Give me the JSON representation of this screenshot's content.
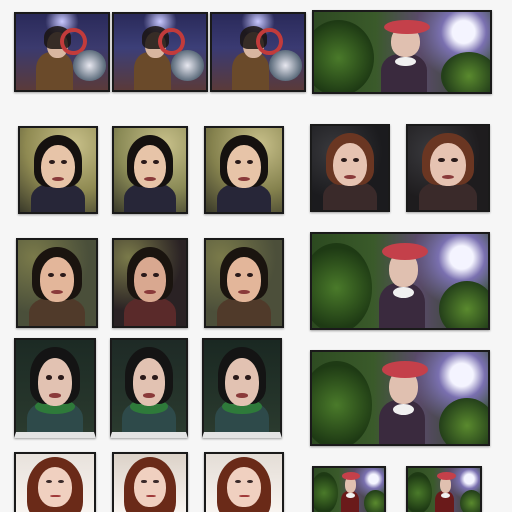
{
  "tiles": [
    {
      "id": "r1c1",
      "kind": "stage",
      "bg": "#3b3a6e",
      "accent": "#c23b3b",
      "hair": "#1a1410",
      "skin": "#d8b6a0",
      "body": "#6a4a2a"
    },
    {
      "id": "r1c2",
      "kind": "stage",
      "bg": "#3c3f78",
      "accent": "#c23b3b",
      "hair": "#1a1410",
      "skin": "#d8b6a0",
      "body": "#6a4a2a"
    },
    {
      "id": "r1c3",
      "kind": "stage",
      "bg": "#3a3a72",
      "accent": "#c23b3b",
      "hair": "#1a1410",
      "skin": "#d8b6a0",
      "body": "#6a4a2a"
    },
    {
      "id": "r1c4",
      "kind": "garden",
      "bg": "#2e4a22",
      "accent": "#c4404a",
      "hair": "#1a1410",
      "skin": "#e0c0b0",
      "body": "#3a2a3e"
    },
    {
      "id": "r2c1",
      "kind": "portrait",
      "bg": "#8f8a52",
      "accent": "#30263a",
      "hair": "#15110f",
      "skin": "#e7c4a8",
      "body": "#272638"
    },
    {
      "id": "r2c2",
      "kind": "portrait",
      "bg": "#8a8a56",
      "accent": "#30263a",
      "hair": "#15110f",
      "skin": "#e7c4a8",
      "body": "#272638"
    },
    {
      "id": "r2c3",
      "kind": "portrait",
      "bg": "#85824e",
      "accent": "#30263a",
      "hair": "#15110f",
      "skin": "#e7c4a8",
      "body": "#272638"
    },
    {
      "id": "r2c4",
      "kind": "dark-portrait",
      "bg": "#1b1b1e",
      "accent": "#7a3a2a",
      "hair": "#6a3622",
      "skin": "#e6c3b2",
      "body": "#3a2a2a"
    },
    {
      "id": "r2c5",
      "kind": "dark-portrait",
      "bg": "#1e1c1e",
      "accent": "#7a3a2a",
      "hair": "#6a3622",
      "skin": "#e6c3b2",
      "body": "#3a2a2a"
    },
    {
      "id": "r3c1",
      "kind": "warm-portrait",
      "bg": "#4a4f3a",
      "accent": "#8a5a2e",
      "hair": "#1a140f",
      "skin": "#e3b69a",
      "body": "#503a2a"
    },
    {
      "id": "r3c2",
      "kind": "warm-portrait",
      "bg": "#2a2224",
      "accent": "#7a3a3a",
      "hair": "#1a140f",
      "skin": "#d9a890",
      "body": "#5a2a2a"
    },
    {
      "id": "r3c3",
      "kind": "warm-portrait",
      "bg": "#4c4f3a",
      "accent": "#8a5a2e",
      "hair": "#1a140f",
      "skin": "#e3b69a",
      "body": "#503a2a"
    },
    {
      "id": "r3c4",
      "kind": "garden",
      "bg": "#2c4a20",
      "accent": "#c4404a",
      "hair": "#1a1410",
      "skin": "#e0c0b0",
      "body": "#3a2a3e"
    },
    {
      "id": "r4c1",
      "kind": "green-portrait",
      "bg": "#1c2a24",
      "accent": "#2e7a3a",
      "hair": "#141414",
      "skin": "#e2c2b2",
      "body": "#2e4a4a"
    },
    {
      "id": "r4c2",
      "kind": "green-portrait",
      "bg": "#1e2a26",
      "accent": "#2e7a3a",
      "hair": "#141414",
      "skin": "#e2c2b2",
      "body": "#2e4a4a"
    },
    {
      "id": "r4c3",
      "kind": "green-portrait",
      "bg": "#1a2822",
      "accent": "#2e7a3a",
      "hair": "#141414",
      "skin": "#e2c2b2",
      "body": "#2e4a4a"
    },
    {
      "id": "r4c4",
      "kind": "garden",
      "bg": "#2e4c22",
      "accent": "#c4404a",
      "hair": "#1a1410",
      "skin": "#e0c0b0",
      "body": "#3a2a3e"
    },
    {
      "id": "r5c1",
      "kind": "red-hair",
      "bg": "#e8e2dc",
      "accent": "#7a2a1a",
      "hair": "#6a2a18",
      "skin": "#f0d0c0",
      "body": "#1a1a1a"
    },
    {
      "id": "r5c2",
      "kind": "red-hair",
      "bg": "#dcd2c8",
      "accent": "#7a2a1a",
      "hair": "#6a2a18",
      "skin": "#f0d0c0",
      "body": "#1a1a1a"
    },
    {
      "id": "r5c3",
      "kind": "red-hair",
      "bg": "#e4ddd6",
      "accent": "#7a2a1a",
      "hair": "#6a2a18",
      "skin": "#f0d0c0",
      "body": "#1a1a1a"
    },
    {
      "id": "r5c4",
      "kind": "small-garden",
      "bg": "#2c4a22",
      "accent": "#c4404a",
      "hair": "#1a1410",
      "skin": "#e0c0b0",
      "body": "#6a1a1a"
    },
    {
      "id": "r5c5",
      "kind": "small-garden",
      "bg": "#2e4c22",
      "accent": "#c4404a",
      "hair": "#1a1410",
      "skin": "#e0c0b0",
      "body": "#6a1a1a"
    }
  ]
}
